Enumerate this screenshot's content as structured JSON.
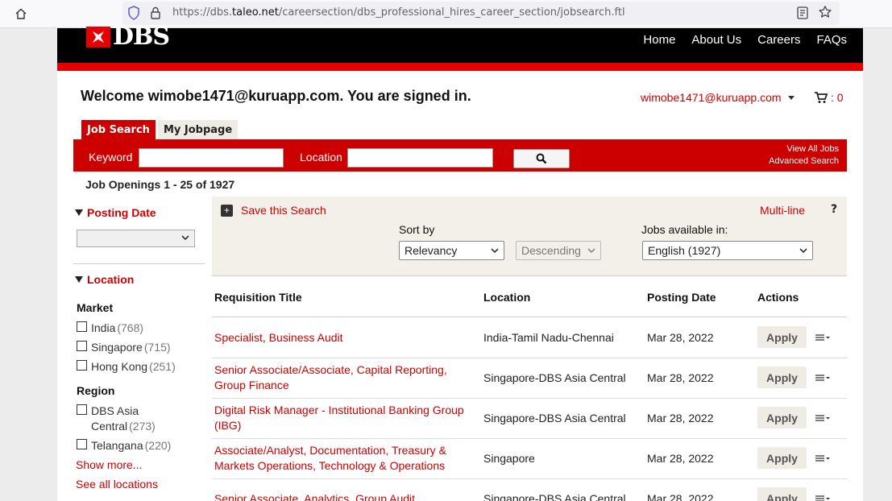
{
  "browser": {
    "url_prefix": "https://dbs.",
    "url_domain": "taleo.net",
    "url_path": "/careersection/dbs_professional_hires_career_section/jobsearch.ftl"
  },
  "header": {
    "logo_text": "DBS",
    "nav": [
      "Home",
      "About Us",
      "Careers",
      "FAQs"
    ]
  },
  "welcome_text": "Welcome wimobe1471@kuruapp.com. You are signed in.",
  "user_email": "wimobe1471@kuruapp.com",
  "cart_count": ": 0",
  "tabs": [
    "Job Search",
    "My Jobpage"
  ],
  "search": {
    "keyword_label": "Keyword",
    "location_label": "Location",
    "keyword_value": "",
    "location_value": "",
    "view_all": "View All Jobs",
    "advanced": "Advanced Search"
  },
  "openings_text": "Job Openings 1 - 25 of 1927",
  "filters": {
    "posting_date_title": "Posting Date",
    "location_title": "Location",
    "market_label": "Market",
    "market": [
      {
        "name": "India",
        "count": "(768)"
      },
      {
        "name": "Singapore",
        "count": "(715)"
      },
      {
        "name": "Hong Kong",
        "count": "(251)"
      }
    ],
    "region_label": "Region",
    "region": [
      {
        "name": "DBS Asia Central",
        "count": "(273)"
      },
      {
        "name": "Telangana",
        "count": "(220)"
      }
    ],
    "show_more": "Show more...",
    "see_all": "See all locations"
  },
  "options": {
    "save_search": "Save this Search",
    "multi_line": "Multi-line",
    "help": "?",
    "sort_label": "Sort by",
    "sort_value": "Relevancy",
    "order_value": "Descending",
    "lang_label": "Jobs available in:",
    "lang_value": "English (1927)"
  },
  "table": {
    "headers": [
      "Requisition Title",
      "Location",
      "Posting Date",
      "Actions"
    ],
    "apply_label": "Apply",
    "rows": [
      {
        "title": "Specialist, Business Audit",
        "location": "India-Tamil Nadu-Chennai",
        "date": "Mar 28, 2022"
      },
      {
        "title": "Senior Associate/Associate, Capital Reporting, Group Finance",
        "location": "Singapore-DBS Asia Central",
        "date": "Mar 28, 2022"
      },
      {
        "title": "Digital Risk Manager - Institutional Banking Group (IBG)",
        "location": "Singapore-DBS Asia Central",
        "date": "Mar 28, 2022"
      },
      {
        "title": "Associate/Analyst, Documentation, Treasury & Markets Operations, Technology & Operations",
        "location": "Singapore",
        "date": "Mar 28, 2022"
      },
      {
        "title": "Senior Associate, Analytics, Group Audit",
        "location": "Singapore-DBS Asia Central",
        "date": "Mar 28, 2022"
      }
    ]
  }
}
